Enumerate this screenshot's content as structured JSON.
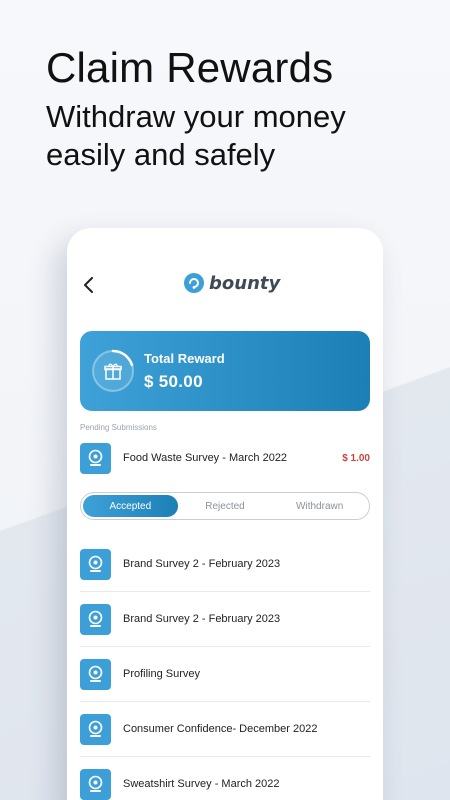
{
  "promo": {
    "headline": "Claim Rewards",
    "subline": "Withdraw your money easily and safely"
  },
  "app": {
    "brand": "bounty",
    "back_icon": "chevron-left-icon",
    "accent_color": "#2a8ec8",
    "danger_color": "#c9463d"
  },
  "reward_card": {
    "title": "Total Reward",
    "amount": "$ 50.00",
    "icon": "gift-icon"
  },
  "pending": {
    "label": "Pending Submissions",
    "items": [
      {
        "name": "Food Waste Survey - March 2022",
        "amount": "$ 1.00"
      }
    ]
  },
  "tabs": [
    {
      "label": "Accepted",
      "active": true
    },
    {
      "label": "Rejected",
      "active": false
    },
    {
      "label": "Withdrawn",
      "active": false
    }
  ],
  "accepted": [
    {
      "name": "Brand Survey 2 - February 2023"
    },
    {
      "name": "Brand Survey 2 - February 2023"
    },
    {
      "name": "Profiling Survey"
    },
    {
      "name": "Consumer Confidence- December 2022"
    },
    {
      "name": "Sweatshirt Survey - March 2022"
    }
  ]
}
